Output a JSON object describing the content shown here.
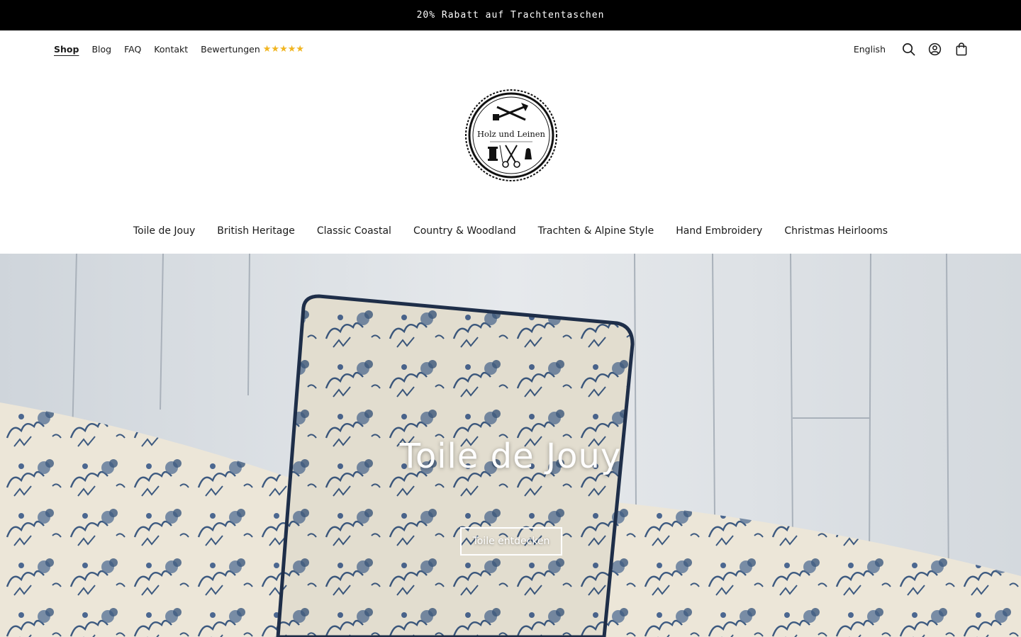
{
  "announcement": {
    "text": "20% Rabatt auf Trachtentaschen"
  },
  "top_nav": {
    "items": [
      {
        "label": "Shop",
        "active": true
      },
      {
        "label": "Blog"
      },
      {
        "label": "FAQ"
      },
      {
        "label": "Kontakt"
      },
      {
        "label": "Bewertungen"
      }
    ],
    "rating_stars": "★★★★★"
  },
  "utility": {
    "language": "English",
    "icons": [
      "search-icon",
      "account-icon",
      "cart-icon"
    ]
  },
  "logo": {
    "text": "Holz und Leinen"
  },
  "category_nav": {
    "items": [
      "Toile de Jouy",
      "British Heritage",
      "Classic Coastal",
      "Country & Woodland",
      "Trachten & Alpine Style",
      "Hand Embroidery",
      "Christmas Heirlooms"
    ]
  },
  "hero": {
    "title": "Toile de Jouy",
    "button_label": "Toile entdecken"
  },
  "colors": {
    "announcement_bg": "#000000",
    "star": "#f1b520",
    "toile_blue": "#3d5a80",
    "toile_cream": "#ece6d8"
  }
}
